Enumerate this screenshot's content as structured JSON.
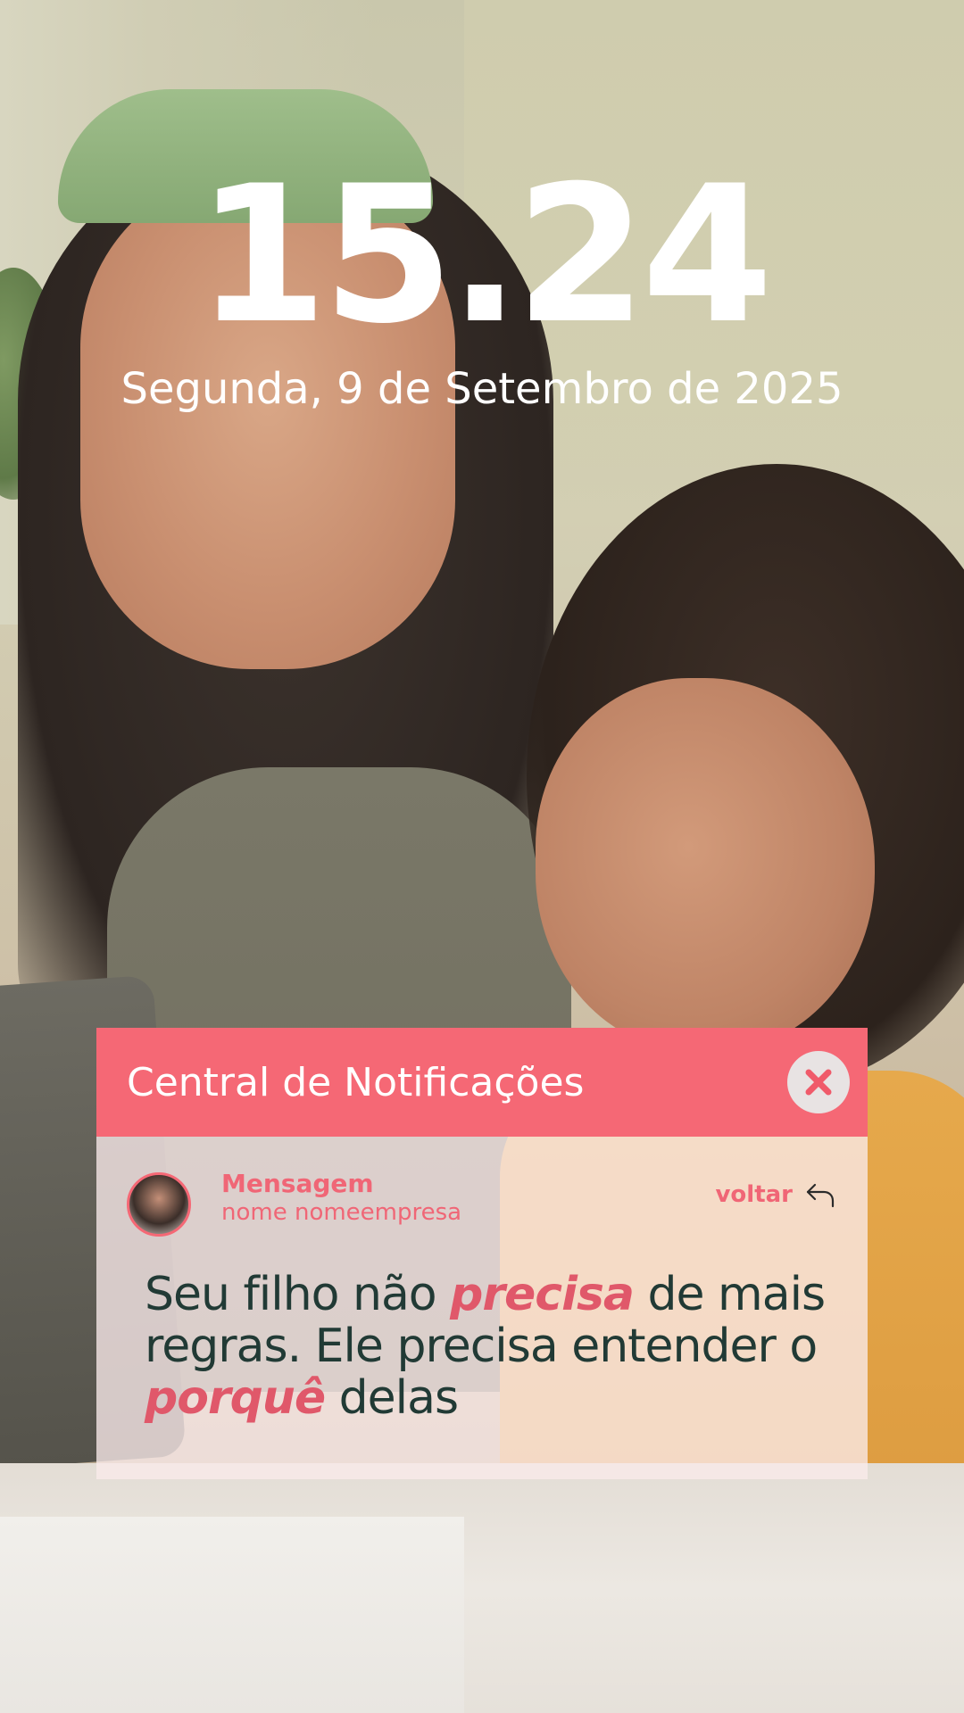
{
  "lockscreen": {
    "time": "15.24",
    "date": "Segunda, 9 de Setembro de 2025"
  },
  "notification_center": {
    "title": "Central de Notificações",
    "close_icon": "close-x-icon",
    "message": {
      "sender": "Mensagem",
      "company": "nome nomeempresa",
      "back_label": "voltar",
      "back_icon": "reply-arrow-icon",
      "text_part1": "Seu filho não ",
      "text_emphasis1": "precisa",
      "text_part2": " de mais regras. Ele precisa entender o ",
      "text_emphasis2": "porquê",
      "text_part3": " delas"
    }
  },
  "colors": {
    "accent": "#f56875",
    "text_dark": "#213a35",
    "panel_body": "#faebeb"
  }
}
